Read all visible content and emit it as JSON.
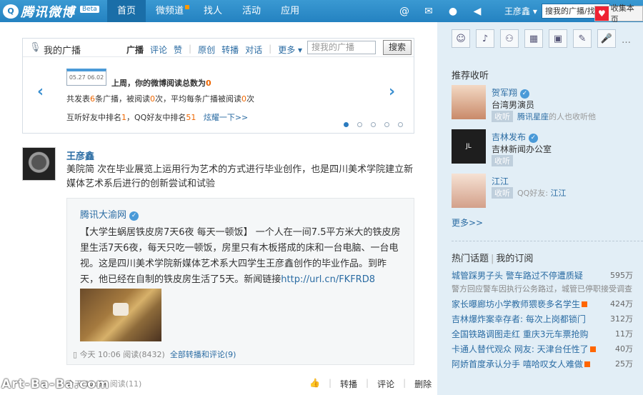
{
  "topbar": {
    "logo_mark": "Q",
    "logo_text": "腾讯微博",
    "beta": "Beta",
    "nav": [
      {
        "label": "首页",
        "active": true
      },
      {
        "label": "微频道",
        "badge": true
      },
      {
        "label": "找人"
      },
      {
        "label": "活动"
      },
      {
        "label": "应用"
      }
    ],
    "user": "王彦鑫 ▾",
    "search_value": "搜我的广播/找人",
    "fav_label": "收集本页"
  },
  "broadcast": {
    "title": "我的广播",
    "tabs": [
      "广播",
      "评论",
      "赞",
      "原创",
      "转播",
      "对话",
      "更多"
    ],
    "search_placeholder": "搜我的广播",
    "search_button": "搜索",
    "calendar": "05.27 06.02",
    "summary_prefix": "上周，你的微博阅读总数为",
    "summary_value": "0",
    "line2": [
      "共发表",
      "6",
      "条广播，被阅读",
      "0",
      "次，平均每条广播被阅读",
      "0",
      "次"
    ],
    "line3": [
      "互听好友中排名",
      "1",
      "，QQ好友中排名",
      "51"
    ],
    "line3_link": "炫耀一下>>"
  },
  "post": {
    "author": "王彦鑫",
    "text": "美院简   次在毕业展览上运用行为艺术的方式进行毕业创作，也是四川美术学院建立新媒体艺术系后进行的创新尝试和试验",
    "quote": {
      "author": "腾讯大渝网",
      "text": "【大学生蜗居铁皮房7天6夜 每天一顿饭】 一个人在一间7.5平方米大的铁皮房里生活7天6夜，每天只吃一顿饭，房里只有木板搭成的床和一台电脑、一台电视。这是四川美术学院新媒体艺术系大四学生王彦鑫创作的毕业作品。到昨天，他已经在自制的铁皮房生活了5天。新闻链接",
      "link": "http://url.cn/FKFRD8",
      "meta_time": "今天 10:06 阅读(8432)",
      "meta_link": "全部转播和评论(9)"
    },
    "footer_meta": "今天 12:54 阅读(11)",
    "actions": [
      "转播",
      "评论",
      "删除"
    ]
  },
  "sidebar": {
    "recommend_title": "推荐收听",
    "recommend": [
      {
        "name": "贺军翔",
        "desc": "台湾男演员",
        "line": [
          "收听",
          "腾讯星座",
          "的人也收听他"
        ]
      },
      {
        "name": "吉林发布",
        "desc": "吉林新闻办公室",
        "line": [
          "收听",
          "",
          ""
        ]
      },
      {
        "name": "江江",
        "desc": "",
        "line": [
          "收听",
          "QQ好友: ",
          "江江"
        ]
      }
    ],
    "more": "更多>>",
    "hot_tab1": "热门话题",
    "hot_tab2": "我的订阅",
    "hot": [
      {
        "title": "城管踩男子头 警车路过不停遭质疑",
        "count": "595万",
        "sub": "警方回应警车因执行公务路过，城管已停职接受调查"
      },
      {
        "title": "家长曝廊坊小学教师猥亵多名学生",
        "count": "424万",
        "new": true
      },
      {
        "title": "吉林爆炸案幸存者: 每次上岗都锁门",
        "count": "312万"
      },
      {
        "title": "全国铁路调图走红 重庆3元车票抢购",
        "count": "11万"
      },
      {
        "title": "卡通人替代观众 网友: 天津台任性了",
        "count": "40万",
        "new": true
      },
      {
        "title": "阿娇首度承认分手 嘻哈叹女人难做",
        "count": "25万",
        "new": true
      }
    ]
  }
}
